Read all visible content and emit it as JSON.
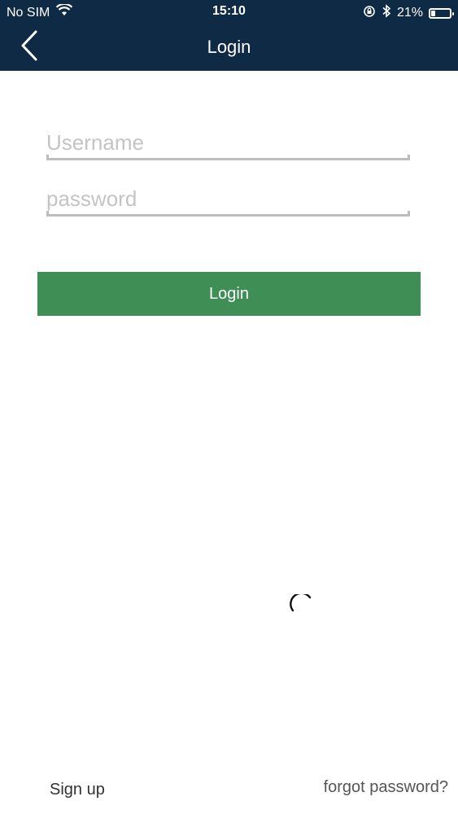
{
  "status_bar": {
    "carrier": "No SIM",
    "time": "15:10",
    "battery_percent_label": "21%",
    "battery_level": 0.21
  },
  "header": {
    "title": "Login",
    "back_icon": "chevron-left-icon"
  },
  "form": {
    "username_placeholder": "Username",
    "password_placeholder": "password",
    "login_label": "Login"
  },
  "footer": {
    "signup_label": "Sign up",
    "forgot_label": "forgot password?"
  },
  "colors": {
    "header_bg": "#0f2a44",
    "button_bg": "#3e8e55"
  }
}
